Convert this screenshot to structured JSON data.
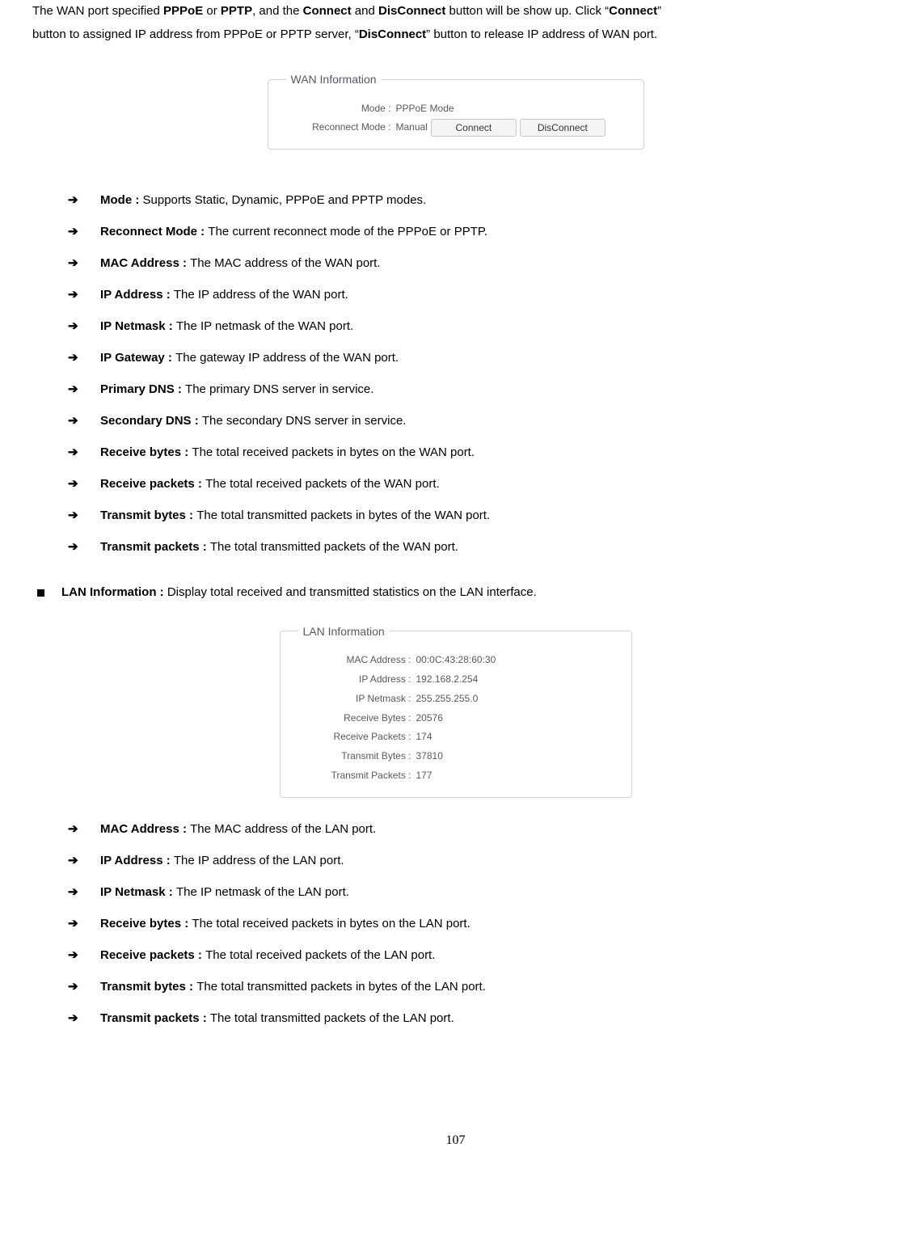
{
  "intro": {
    "t1a": "The WAN port specified ",
    "t1b": "PPPoE",
    "t1c": " or ",
    "t1d": "PPTP",
    "t1e": ", and the ",
    "t1f": "Connect",
    "t1g": " and ",
    "t1h": "DisConnect",
    "t1i": " button will be show up. Click “",
    "t1j": "Connect",
    "t1k": "”",
    "t2a": "button to assigned IP address from PPPoE or PPTP server, “",
    "t2b": "DisConnect",
    "t2c": "” button to release IP address of WAN port."
  },
  "wan_figure": {
    "legend": "WAN Information",
    "mode_label": "Mode :",
    "mode_value": "PPPoE Mode",
    "reconnect_label": "Reconnect Mode :",
    "reconnect_value": "Manual",
    "connect_btn": "Connect",
    "disconnect_btn": "DisConnect"
  },
  "list1": {
    "i0": {
      "term": "Mode : ",
      "desc": "Supports Static, Dynamic, PPPoE and PPTP modes."
    },
    "i1": {
      "term": "Reconnect Mode : ",
      "desc": "The current reconnect mode of the PPPoE or PPTP."
    },
    "i2": {
      "term": "MAC Address : ",
      "desc": "The MAC address of the WAN port."
    },
    "i3": {
      "term": "IP Address : ",
      "desc": "The IP address of the WAN port."
    },
    "i4": {
      "term": "IP Netmask : ",
      "desc": "The IP netmask of the WAN port."
    },
    "i5": {
      "term": "IP Gateway : ",
      "desc": "The gateway IP address of the WAN port."
    },
    "i6": {
      "term": "Primary DNS : ",
      "desc": "The primary DNS server in service."
    },
    "i7": {
      "term": "Secondary DNS : ",
      "desc": "The secondary DNS server in service."
    },
    "i8": {
      "term": "Receive bytes : ",
      "desc": "The total received packets in bytes on the WAN port."
    },
    "i9": {
      "term": "Receive packets : ",
      "desc": "The total received packets of the WAN port."
    },
    "i10": {
      "term": "Transmit bytes : ",
      "desc": "The total transmitted packets in bytes of the WAN port."
    },
    "i11": {
      "term": "Transmit packets : ",
      "desc": "The total transmitted packets of the WAN port."
    }
  },
  "lan_heading": {
    "term": "LAN Information : ",
    "desc": "Display total received and transmitted statistics on the LAN interface."
  },
  "lan_figure": {
    "legend": "LAN Information",
    "r0": {
      "label": "MAC Address :",
      "value": "00:0C:43:28:60:30"
    },
    "r1": {
      "label": "IP Address :",
      "value": "192.168.2.254"
    },
    "r2": {
      "label": "IP Netmask :",
      "value": "255.255.255.0"
    },
    "r3": {
      "label": "Receive Bytes :",
      "value": "20576"
    },
    "r4": {
      "label": "Receive Packets :",
      "value": "174"
    },
    "r5": {
      "label": "Transmit Bytes :",
      "value": "37810"
    },
    "r6": {
      "label": "Transmit Packets :",
      "value": "177"
    }
  },
  "list2": {
    "i0": {
      "term": "MAC Address : ",
      "desc": "The MAC address of the LAN port."
    },
    "i1": {
      "term": "IP Address : ",
      "desc": "The IP address of the LAN port."
    },
    "i2": {
      "term": "IP Netmask : ",
      "desc": "The IP netmask of the LAN port."
    },
    "i3": {
      "term": "Receive bytes : ",
      "desc": "The total received packets in bytes on the LAN port."
    },
    "i4": {
      "term": "Receive packets : ",
      "desc": "The total received packets of the LAN port."
    },
    "i5": {
      "term": "Transmit bytes : ",
      "desc": "The total transmitted packets in bytes of the LAN port."
    },
    "i6": {
      "term": "Transmit packets : ",
      "desc": "The total transmitted packets of the LAN port."
    }
  },
  "page_number": "107"
}
